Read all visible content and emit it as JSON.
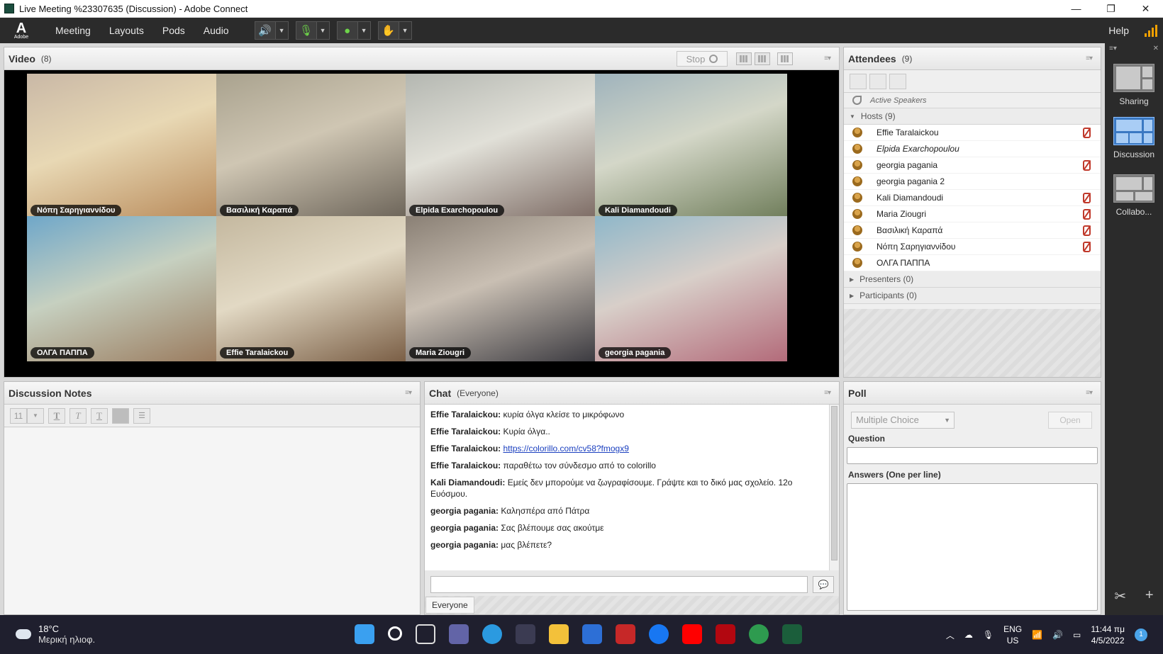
{
  "window": {
    "title": "Live Meeting %23307635 (Discussion) - Adobe Connect",
    "controls": [
      "—",
      "❐",
      "✕"
    ]
  },
  "menubar": {
    "logo_text": "Adobe",
    "items": [
      "Meeting",
      "Layouts",
      "Pods",
      "Audio"
    ],
    "help": "Help"
  },
  "video": {
    "title": "Video",
    "count": "(8)",
    "stop_label": "Stop",
    "tiles": [
      {
        "name": "Νόπη Σαρηγιαννίδου",
        "colors": [
          "#c9b8a6",
          "#e8d8b4",
          "#b88a5a"
        ]
      },
      {
        "name": "Βασιλική Καραπά",
        "colors": [
          "#a9a28e",
          "#cfc6b3",
          "#6b6358"
        ]
      },
      {
        "name": "Elpida Exarchopoulou",
        "colors": [
          "#b4b7b1",
          "#e1e0d8",
          "#7c6a63"
        ]
      },
      {
        "name": "Kali Diamandoudi",
        "colors": [
          "#9fb3bc",
          "#d4d7c8",
          "#6f7d5a"
        ]
      },
      {
        "name": "ΟΛΓΑ  ΠΑΠΠΑ",
        "colors": [
          "#6fa7c9",
          "#c6d0c0",
          "#9a7b5e"
        ]
      },
      {
        "name": "Effie Taralaickou",
        "colors": [
          "#c4b89f",
          "#e2d9c4",
          "#7a5e45"
        ]
      },
      {
        "name": "Maria Ziougri",
        "colors": [
          "#8a8075",
          "#c9bfb3",
          "#3b3a40"
        ]
      },
      {
        "name": "georgia pagania",
        "colors": [
          "#8fb7c9",
          "#d8cfc9",
          "#b36b7a"
        ]
      }
    ]
  },
  "attendees": {
    "title": "Attendees",
    "count": "(9)",
    "active_speakers": "Active Speakers",
    "hosts_label": "Hosts (9)",
    "hosts": [
      {
        "name": "Effie Taralaickou",
        "mic_muted": true,
        "italic": false
      },
      {
        "name": "Elpida Exarchopoulou",
        "mic_muted": false,
        "italic": true
      },
      {
        "name": "georgia pagania",
        "mic_muted": true,
        "italic": false
      },
      {
        "name": "georgia pagania 2",
        "mic_muted": false,
        "italic": false
      },
      {
        "name": "Kali Diamandoudi",
        "mic_muted": true,
        "italic": false
      },
      {
        "name": "Maria Ziougri",
        "mic_muted": true,
        "italic": false
      },
      {
        "name": "Βασιλική Καραπά",
        "mic_muted": true,
        "italic": false
      },
      {
        "name": "Νόπη Σαρηγιαννίδου",
        "mic_muted": true,
        "italic": false
      },
      {
        "name": "ΟΛΓΑ  ΠΑΠΠΑ",
        "mic_muted": false,
        "italic": false
      }
    ],
    "presenters_label": "Presenters (0)",
    "participants_label": "Participants (0)"
  },
  "layouts": [
    {
      "label": "Sharing",
      "selected": false
    },
    {
      "label": "Discussion",
      "selected": true
    },
    {
      "label": "Collabo...",
      "selected": false
    }
  ],
  "notes": {
    "title": "Discussion Notes",
    "font_size": "11"
  },
  "chat": {
    "title": "Chat",
    "scope": "(Everyone)",
    "messages": [
      {
        "sender": "Effie Taralaickou:",
        "text": "κυρία όλγα κλείσε το μικρόφωνο",
        "link": ""
      },
      {
        "sender": "Effie Taralaickou:",
        "text": "Κυρία όλγα..",
        "link": ""
      },
      {
        "sender": "Effie Taralaickou:",
        "text": "",
        "link": "https://colorillo.com/cv58?fmogx9"
      },
      {
        "sender": "Effie Taralaickou:",
        "text": "παραθέτω τον σύνδεσμο από το colorillo",
        "link": ""
      },
      {
        "sender": "Kali Diamandoudi:",
        "text": "Εμείς δεν μπορούμε να ζωγραφίσουμε. Γράψτε και το δικό μας σχολείο. 12ο Ευόσμου.",
        "link": ""
      },
      {
        "sender": "georgia pagania:",
        "text": "Καλησπέρα από Πάτρα",
        "link": ""
      },
      {
        "sender": "georgia pagania:",
        "text": "Σας βλέπουμε σας ακούτμε",
        "link": ""
      },
      {
        "sender": "georgia pagania:",
        "text": "μας βλέπετε?",
        "link": ""
      }
    ],
    "tab_label": "Everyone"
  },
  "poll": {
    "title": "Poll",
    "type_label": "Multiple Choice",
    "open_label": "Open",
    "question_label": "Question",
    "answers_label": "Answers (One per line)"
  },
  "taskbar": {
    "temperature": "18°C",
    "weather": "Μερική ηλιοφ.",
    "lang_top": "ENG",
    "lang_bottom": "US",
    "time": "11:44 πμ",
    "date": "4/5/2022",
    "notifications": "1",
    "icons": [
      {
        "name": "windows-start-icon",
        "color": "#3aa0f0"
      },
      {
        "name": "search-icon",
        "color": "#1f1f2e"
      },
      {
        "name": "task-view-icon",
        "color": "#1f1f2e"
      },
      {
        "name": "teams-chat-icon",
        "color": "#6264a7"
      },
      {
        "name": "edge-icon",
        "color": "#2b9ae0"
      },
      {
        "name": "store-icon",
        "color": "#3b3b52"
      },
      {
        "name": "file-explorer-icon",
        "color": "#f3c13a"
      },
      {
        "name": "app-icon",
        "color": "#2d6fd6"
      },
      {
        "name": "mcafee-icon",
        "color": "#c62828"
      },
      {
        "name": "facebook-icon",
        "color": "#1877f2"
      },
      {
        "name": "youtube-icon",
        "color": "#ff0000"
      },
      {
        "name": "netflix-icon",
        "color": "#b20710"
      },
      {
        "name": "chrome-icon",
        "color": "#2e9b4f"
      },
      {
        "name": "adobe-connect-icon",
        "color": "#1b5e3b"
      }
    ]
  }
}
